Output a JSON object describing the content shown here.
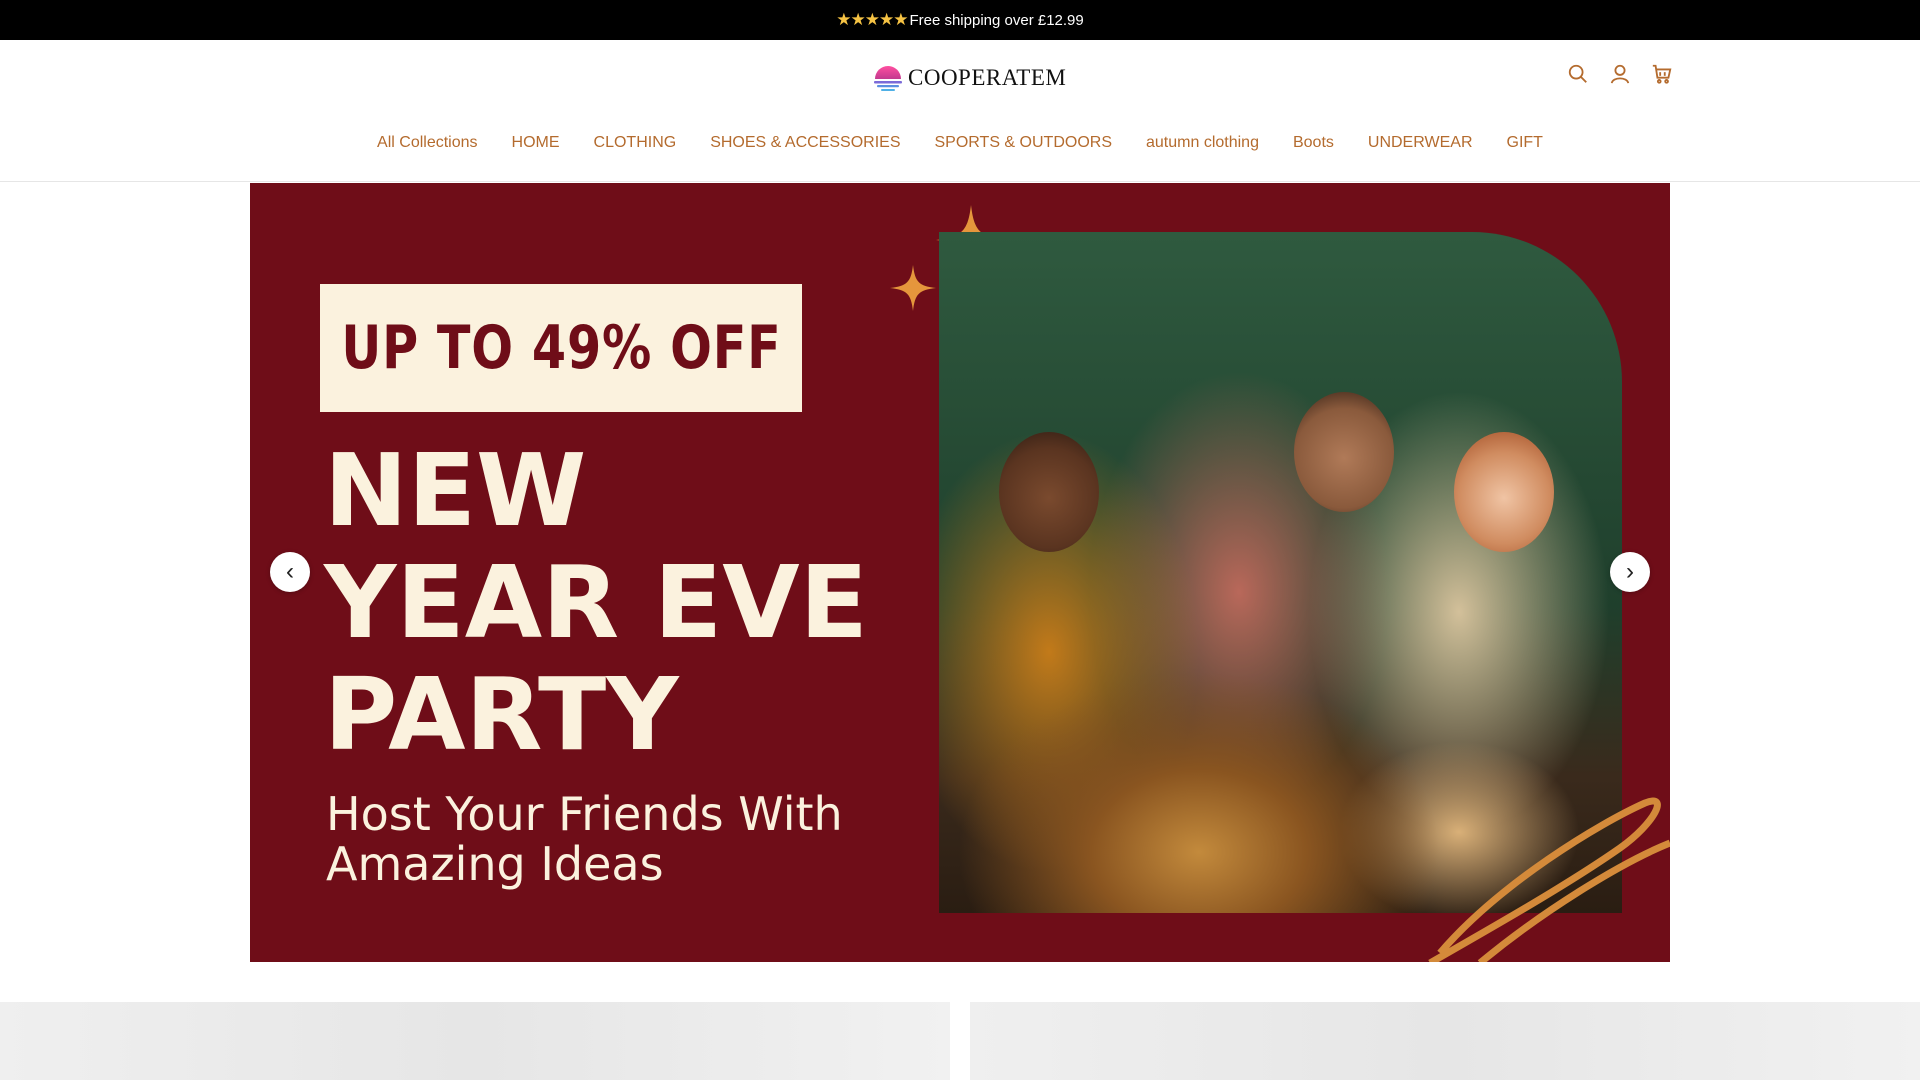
{
  "announcement": {
    "stars": "★★★★★",
    "text": "Free shipping over £12.99"
  },
  "header": {
    "logo_text": "COOPERATEM",
    "icons": [
      "search-icon",
      "account-icon",
      "cart-icon"
    ]
  },
  "nav": {
    "items": [
      "All Collections",
      "HOME",
      "CLOTHING",
      "SHOES & ACCESSORIES",
      "SPORTS & OUTDOORS",
      "autumn clothing",
      "Boots",
      "UNDERWEAR",
      "GIFT"
    ]
  },
  "hero": {
    "offer": "UP TO 49% OFF",
    "headline_lines": [
      "NEW",
      "YEAR EVE",
      "PARTY"
    ],
    "subline_lines": [
      "Host Your Friends With",
      "Amazing Ideas"
    ],
    "prev_icon": "‹",
    "next_icon": "›"
  },
  "colors": {
    "brand_accent": "#b46b2e",
    "hero_bg": "#6f0d18",
    "hero_text": "#fbf2de",
    "sparkle": "#e5963c"
  }
}
